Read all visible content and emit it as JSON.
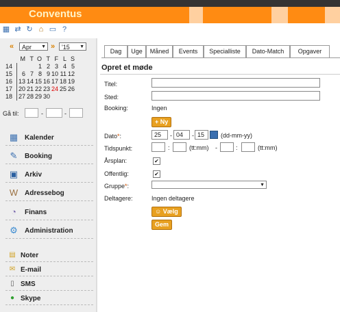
{
  "app": {
    "brand": "Conventus"
  },
  "toolbar": {
    "icons": [
      "calendar-grid-icon",
      "sync-arrows-icon",
      "refresh-icon",
      "home-icon",
      "monitor-icon",
      "help-icon"
    ]
  },
  "calendar": {
    "prev": "«",
    "next": "»",
    "month": "Apr",
    "year": "'15",
    "weekdays": [
      "M",
      "T",
      "O",
      "T",
      "F",
      "L",
      "S"
    ],
    "weeks": [
      {
        "wk": "14",
        "days": [
          "",
          "",
          "1",
          "2",
          "3",
          "4",
          "5"
        ]
      },
      {
        "wk": "15",
        "days": [
          "6",
          "7",
          "8",
          "9",
          "10",
          "11",
          "12"
        ]
      },
      {
        "wk": "16",
        "days": [
          "13",
          "14",
          "15",
          "16",
          "17",
          "18",
          "19"
        ]
      },
      {
        "wk": "17",
        "days": [
          "20",
          "21",
          "22",
          "23",
          "24",
          "25",
          "26"
        ]
      },
      {
        "wk": "18",
        "days": [
          "27",
          "28",
          "29",
          "30",
          "",
          "",
          ""
        ]
      }
    ],
    "today": "24",
    "goto_label": "Gå til:"
  },
  "nav": [
    {
      "label": "Kalender",
      "icon": "calendar-icon"
    },
    {
      "label": "Booking",
      "icon": "booking-icon"
    },
    {
      "label": "Arkiv",
      "icon": "archive-icon"
    },
    {
      "label": "Adressebog",
      "icon": "addressbook-icon"
    },
    {
      "label": "Finans",
      "icon": "finance-icon"
    },
    {
      "label": "Administration",
      "icon": "administration-icon"
    }
  ],
  "nav2": [
    {
      "label": "Noter",
      "icon": "note-icon"
    },
    {
      "label": "E-mail",
      "icon": "email-icon"
    },
    {
      "label": "SMS",
      "icon": "sms-icon"
    },
    {
      "label": "Skype",
      "icon": "skype-icon"
    }
  ],
  "tabs": [
    "Dag",
    "Uge",
    "Måned",
    "Events",
    "Specialliste",
    "Dato-Match",
    "Opgaver"
  ],
  "form": {
    "title": "Opret et møde",
    "titel_label": "Titel:",
    "titel_value": "",
    "sted_label": "Sted:",
    "sted_value": "",
    "booking_label": "Booking:",
    "booking_value": "Ingen",
    "ny_button": "Ny",
    "dato_label": "Dato",
    "dato_day": "25",
    "dato_month": "04",
    "dato_year": "15",
    "dato_format": "(dd-mm-yy)",
    "tidspunkt_label": "Tidspunkt:",
    "time_format": "(tt:mm)",
    "time_sep": "-",
    "aarsplan_label": "Årsplan:",
    "aarsplan_checked": true,
    "offentlig_label": "Offentlig:",
    "offentlig_checked": true,
    "gruppe_label": "Gruppe",
    "gruppe_value": "",
    "deltagere_label": "Deltagere:",
    "deltagere_value": "Ingen deltagere",
    "vaelg_button": "Vælg",
    "gem_button": "Gem"
  }
}
